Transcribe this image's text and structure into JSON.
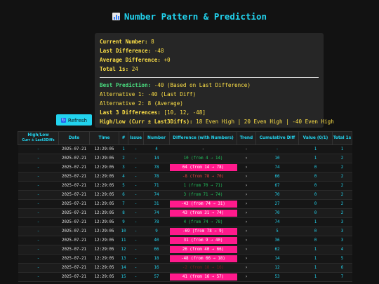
{
  "header": {
    "title": "Number Pattern & Prediction"
  },
  "stats": {
    "current_label": "Current Number:",
    "current_value": "8",
    "last_diff_label": "Last Difference:",
    "last_diff_value": "-48",
    "avg_diff_label": "Average Difference:",
    "avg_diff_value": "+0",
    "total_label": "Total 1s:",
    "total_value": "24"
  },
  "predictions": {
    "best_label": "Best Prediction:",
    "best_value": "-40 (Based on Last Difference)",
    "alt1": "Alternative 1: -40 (Last Diff)",
    "alt2": "Alternative 2: 8 (Average)",
    "last3_label": "Last 3 Differences:",
    "last3_value": "[10, 12, -48]",
    "hilo_label": "High/Low (Curr ± Last3Diffs):",
    "hilo_value": "18 Even High | 20 Even High | -40 Even High"
  },
  "toolbar": {
    "refresh_label": "Refresh"
  },
  "table": {
    "headers": {
      "hilo_line1": "High/Low",
      "hilo_line2": "Curr ± Last3Diffs",
      "date": "Date",
      "time": "Time",
      "num": "#",
      "issue": "Issue",
      "number": "Number",
      "diff": "Difference (with Numbers)",
      "trend": "Trend",
      "cum": "Cumulative Diff",
      "value": "Value (0/1)",
      "total": "Total 1s"
    },
    "rows": [
      {
        "hilo": "-",
        "date": "2025-07-21",
        "time": "12:29:05",
        "num": "1",
        "issue": "-",
        "number": "4",
        "diff": "-",
        "diff_kind": "zero",
        "trend": "-",
        "cum": "-",
        "value": "1",
        "total": "1"
      },
      {
        "hilo": "-",
        "date": "2025-07-21",
        "time": "12:29:05",
        "num": "2",
        "issue": "-",
        "number": "14",
        "diff": "10 (from 4 → 14)",
        "diff_kind": "pos",
        "trend": "›",
        "cum": "10",
        "value": "1",
        "total": "2"
      },
      {
        "hilo": "-",
        "date": "2025-07-21",
        "time": "12:29:05",
        "num": "3",
        "issue": "-",
        "number": "78",
        "diff": "64 (from 14 → 78)",
        "diff_kind": "neg",
        "trend": "›",
        "cum": "74",
        "value": "0",
        "total": "2"
      },
      {
        "hilo": "-",
        "date": "2025-07-21",
        "time": "12:29:05",
        "num": "4",
        "issue": "-",
        "number": "78",
        "diff": "-8 (from 78 → 70)",
        "diff_kind": "dimred",
        "trend": "›",
        "cum": "66",
        "value": "0",
        "total": "2"
      },
      {
        "hilo": "-",
        "date": "2025-07-21",
        "time": "12:29:05",
        "num": "5",
        "issue": "-",
        "number": "71",
        "diff": "1 (from 70 → 71)",
        "diff_kind": "pos",
        "trend": "›",
        "cum": "67",
        "value": "0",
        "total": "2"
      },
      {
        "hilo": "-",
        "date": "2025-07-21",
        "time": "12:29:05",
        "num": "6",
        "issue": "-",
        "number": "74",
        "diff": "3 (from 71 → 74)",
        "diff_kind": "pos",
        "trend": "›",
        "cum": "70",
        "value": "0",
        "total": "2"
      },
      {
        "hilo": "-",
        "date": "2025-07-21",
        "time": "12:29:05",
        "num": "7",
        "issue": "-",
        "number": "31",
        "diff": "-43 (from 74 → 31)",
        "diff_kind": "neg",
        "trend": "›",
        "cum": "27",
        "value": "0",
        "total": "2"
      },
      {
        "hilo": "-",
        "date": "2025-07-21",
        "time": "12:29:05",
        "num": "8",
        "issue": "-",
        "number": "74",
        "diff": "43 (from 31 → 74)",
        "diff_kind": "neg",
        "trend": "›",
        "cum": "70",
        "value": "0",
        "total": "2"
      },
      {
        "hilo": "-",
        "date": "2025-07-21",
        "time": "12:29:05",
        "num": "9",
        "issue": "-",
        "number": "78",
        "diff": "4 (from 74 → 78)",
        "diff_kind": "pos",
        "trend": "›",
        "cum": "74",
        "value": "1",
        "total": "3"
      },
      {
        "hilo": "-",
        "date": "2025-07-21",
        "time": "12:29:05",
        "num": "10",
        "issue": "-",
        "number": "9",
        "diff": "-69 (from 78 → 9)",
        "diff_kind": "neg",
        "trend": "›",
        "cum": "5",
        "value": "0",
        "total": "3"
      },
      {
        "hilo": "-",
        "date": "2025-07-21",
        "time": "12:29:05",
        "num": "11",
        "issue": "-",
        "number": "40",
        "diff": "31 (from 9 → 40)",
        "diff_kind": "neg",
        "trend": "›",
        "cum": "36",
        "value": "0",
        "total": "3"
      },
      {
        "hilo": "-",
        "date": "2025-07-21",
        "time": "12:29:05",
        "num": "12",
        "issue": "-",
        "number": "66",
        "diff": "26 (from 40 → 66)",
        "diff_kind": "neg",
        "trend": "›",
        "cum": "62",
        "value": "1",
        "total": "4"
      },
      {
        "hilo": "-",
        "date": "2025-07-21",
        "time": "12:29:05",
        "num": "13",
        "issue": "-",
        "number": "18",
        "diff": "-48 (from 66 → 18)",
        "diff_kind": "neg",
        "trend": "›",
        "cum": "14",
        "value": "1",
        "total": "5"
      },
      {
        "hilo": "-",
        "date": "2025-07-21",
        "time": "12:29:05",
        "num": "14",
        "issue": "-",
        "number": "16",
        "diff": "-2 (from 18 → 16)",
        "diff_kind": "dim",
        "trend": "›",
        "cum": "12",
        "value": "1",
        "total": "6"
      },
      {
        "hilo": "-",
        "date": "2025-07-21",
        "time": "12:29:05",
        "num": "15",
        "issue": "-",
        "number": "57",
        "diff": "41 (from 16 → 57)",
        "diff_kind": "neg",
        "trend": "›",
        "cum": "53",
        "value": "1",
        "total": "7"
      }
    ]
  }
}
